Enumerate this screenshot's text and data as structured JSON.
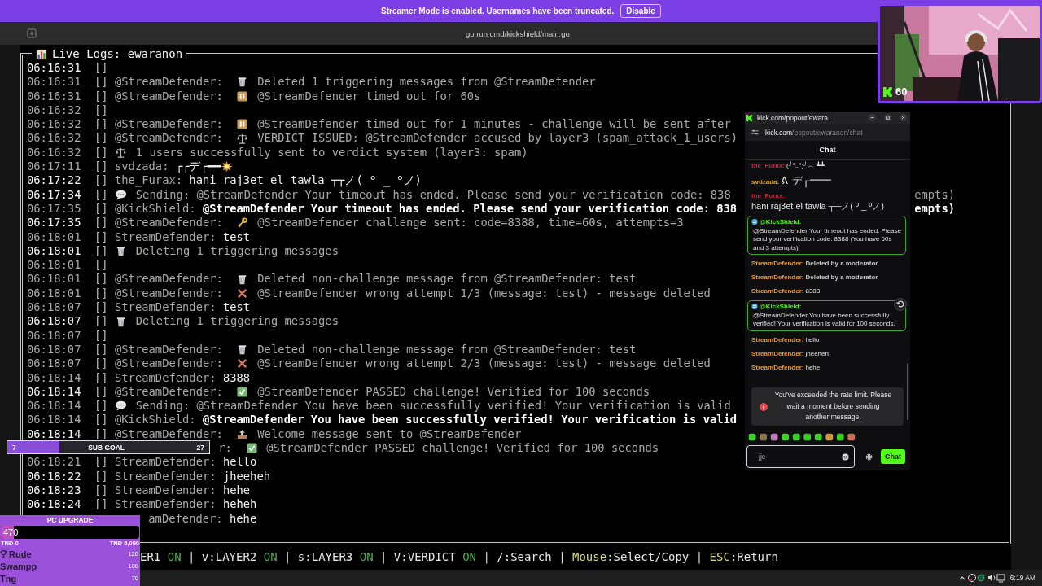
{
  "banner": {
    "text": "Streamer Mode is enabled. Usernames have been truncated.",
    "button": "Disable"
  },
  "terminal": {
    "title": "go run cmd/kickshield/main.go",
    "panel_title": "Live Logs: ewaranon",
    "lines": [
      {
        "kind": "blank",
        "time": "06:16:31",
        "bright": true,
        "tag": "[]"
      },
      {
        "kind": "trash",
        "time": "06:16:31",
        "bright": false,
        "tag": "[]",
        "author": "@StreamDefender:",
        "text": "Deleted 1 triggering messages from @StreamDefender"
      },
      {
        "kind": "pause",
        "time": "06:16:31",
        "bright": false,
        "tag": "[]",
        "author": "@StreamDefender:",
        "text": "@StreamDefender timed out for 60s"
      },
      {
        "kind": "blank",
        "time": "06:16:32",
        "bright": false,
        "tag": "[]"
      },
      {
        "kind": "pause",
        "time": "06:16:32",
        "bright": false,
        "tag": "[]",
        "author": "@StreamDefender:",
        "text": "@StreamDefender timed out for 1 minutes - challenge will be sent after"
      },
      {
        "kind": "scale",
        "time": "06:16:32",
        "bright": false,
        "tag": "[]",
        "author": "@StreamDefender:",
        "text": "VERDICT ISSUED: @StreamDefender accused by layer3 (spam_attack_1_users)"
      },
      {
        "kind": "scale",
        "time": "06:16:32",
        "bright": false,
        "tag": "[]",
        "text": "1 users successfully sent to verdict system (layer3: spam)"
      },
      {
        "kind": "burst",
        "time": "06:17:11",
        "bright": false,
        "tag": "[]",
        "author": "svdzada:",
        "text": "┌┌デ┌━━"
      },
      {
        "kind": "chat",
        "time": "06:17:22",
        "bright": true,
        "tag": "[]",
        "author": "the_Furax:",
        "text": "hani raj3et el tawla ┬┬ノ( º _ ºノ)"
      },
      {
        "kind": "speech",
        "time": "06:17:34",
        "bright": true,
        "tag": "[]",
        "text": "Sending: @StreamDefender Your timeout has ended. Please send your verification code: 838",
        "tail": "empts)"
      },
      {
        "kind": "bot",
        "time": "06:17:35",
        "bright": false,
        "tag": "[]",
        "author": "@KickShield:",
        "text": "@StreamDefender Your timeout has ended. Please send your verification code: 838",
        "tail": "empts)"
      },
      {
        "kind": "key",
        "time": "06:17:35",
        "bright": true,
        "tag": "[]",
        "author": "@StreamDefender:",
        "text": "@StreamDefender challenge sent: code=8388, time=60s, attempts=3"
      },
      {
        "kind": "chat",
        "time": "06:18:01",
        "bright": false,
        "tag": "[]",
        "author": "StreamDefender:",
        "text": "test"
      },
      {
        "kind": "trash",
        "time": "06:18:01",
        "bright": true,
        "tag": "[]",
        "text": "Deleting 1 triggering messages"
      },
      {
        "kind": "blank",
        "time": "06:18:01",
        "bright": false,
        "tag": "[]"
      },
      {
        "kind": "trash",
        "time": "06:18:01",
        "bright": false,
        "tag": "[]",
        "author": "@StreamDefender:",
        "text": "Deleted non-challenge message from @StreamDefender: test"
      },
      {
        "kind": "cross",
        "time": "06:18:01",
        "bright": false,
        "tag": "[]",
        "author": "@StreamDefender:",
        "text": "@StreamDefender wrong attempt 1/3 (message: test) - message deleted"
      },
      {
        "kind": "chat",
        "time": "06:18:07",
        "bright": false,
        "tag": "[]",
        "author": "StreamDefender:",
        "text": "test"
      },
      {
        "kind": "trash",
        "time": "06:18:07",
        "bright": true,
        "tag": "[]",
        "text": "Deleting 1 triggering messages"
      },
      {
        "kind": "blank",
        "time": "06:18:07",
        "bright": false,
        "tag": "[]"
      },
      {
        "kind": "trash",
        "time": "06:18:07",
        "bright": false,
        "tag": "[]",
        "author": "@StreamDefender:",
        "text": "Deleted non-challenge message from @StreamDefender: test"
      },
      {
        "kind": "cross",
        "time": "06:18:07",
        "bright": false,
        "tag": "[]",
        "author": "@StreamDefender:",
        "text": "@StreamDefender wrong attempt 2/3 (message: test) - message deleted"
      },
      {
        "kind": "chat",
        "time": "06:18:14",
        "bright": false,
        "tag": "[]",
        "author": "StreamDefender:",
        "text": "8388"
      },
      {
        "kind": "check",
        "time": "06:18:14",
        "bright": true,
        "tag": "[]",
        "author": "@StreamDefender:",
        "text": "@StreamDefender PASSED challenge! Verified for 100 seconds"
      },
      {
        "kind": "speech",
        "time": "06:18:14",
        "bright": false,
        "tag": "[]",
        "text": "Sending: @StreamDefender You have been successfully verified! Your verification is valid"
      },
      {
        "kind": "bot",
        "time": "06:18:14",
        "bright": false,
        "tag": "[]",
        "author": "@KickShield:",
        "text": "@StreamDefender You have been successfully verified! Your verification is valid"
      },
      {
        "kind": "outbox",
        "time": "06:18:14",
        "bright": true,
        "tag": "[]",
        "author": "@StreamDefender:",
        "text": "Welcome message sent to @StreamDefender"
      },
      {
        "kind": "check",
        "author": "r:",
        "text": "@StreamDefender PASSED challenge! Verified for 100 seconds"
      },
      {
        "kind": "chat",
        "time": "06:18:21",
        "bright": false,
        "tag": "[]",
        "author": "StreamDefender:",
        "text": "hello"
      },
      {
        "kind": "chat",
        "time": "06:18:22",
        "bright": true,
        "tag": "[]",
        "author": "StreamDefender:",
        "text": "jheeheh"
      },
      {
        "kind": "chat",
        "time": "06:18:23",
        "bright": true,
        "tag": "[]",
        "author": "StreamDefender:",
        "text": "hehe"
      },
      {
        "kind": "chat",
        "time": "06:18:24",
        "bright": true,
        "tag": "[]",
        "author": "StreamDefender:",
        "text": "heheh"
      },
      {
        "kind": "chat",
        "author": "amDefender:",
        "text": "hehe"
      }
    ],
    "status_bar": {
      "separator": "|",
      "items": [
        {
          "text": "ER1",
          "state": "ON"
        },
        {
          "text": "v:LAYER2",
          "state": "ON"
        },
        {
          "text": "s:LAYER3",
          "state": "ON"
        },
        {
          "text": "V:VERDICT",
          "state": "ON"
        },
        {
          "text": "/:Search"
        },
        {
          "key": "Mouse",
          "text": ":Select/Copy"
        },
        {
          "key": "ESC",
          "text": ":Return"
        }
      ]
    }
  },
  "chat_window": {
    "title": "kick.com/popout/ewara...",
    "url_host": "kick.com",
    "url_path": "/popout/ewaranon/chat",
    "header": "Chat",
    "messages": [
      {
        "kind": "user",
        "author": "the_Furax:",
        "color": "#c8203c",
        "text": "(╯°□°)╯︵ ┻┻"
      },
      {
        "kind": "user",
        "author": "svdzada:",
        "color": "#e0a42c",
        "text": "ᕕ·デ┌━━"
      },
      {
        "kind": "user",
        "author": "the_Furax:",
        "color": "#c8203c",
        "text": "hani raj3et el tawla ┬┬ノ( º _ ºノ)"
      },
      {
        "kind": "bot",
        "author": "@KickShield:",
        "color": "#53fc18",
        "text": "@StreamDefender Your timeout has ended. Please send your verification code: 8388 (You have 60s and 3 attempts)"
      },
      {
        "kind": "deleted",
        "author": "StreamDefender:",
        "color": "#e8962e",
        "text": "Deleted by a moderator"
      },
      {
        "kind": "deleted",
        "author": "StreamDefender:",
        "color": "#e8962e",
        "text": "Deleted by a moderator"
      },
      {
        "kind": "user",
        "author": "StreamDefender:",
        "color": "#e8962e",
        "text": "8388"
      },
      {
        "kind": "bot",
        "author": "@KickShield:",
        "color": "#53fc18",
        "text": "@StreamDefender You have been successfully verified! Your verification is valid for 100 seconds."
      },
      {
        "kind": "user",
        "author": "StreamDefender:",
        "color": "#e8962e",
        "text": "hello"
      },
      {
        "kind": "user",
        "author": "StreamDefender:",
        "color": "#e8962e",
        "text": "jheeheh"
      },
      {
        "kind": "user",
        "author": "StreamDefender:",
        "color": "#e8962e",
        "text": "hehe"
      }
    ],
    "toast": "You've exceeded the rate limit. Please wait a moment before sending another message.",
    "input_value": "jje",
    "send_button": "Chat"
  },
  "webcam": {
    "kind": "picture",
    "viewers": "60"
  },
  "sub_goal": {
    "current": "7",
    "label": "SUB GOAL",
    "target": "27",
    "level": 0.26
  },
  "pc_upgrade": {
    "title": "PC UPGRADE",
    "amount": "470",
    "level": 0.094,
    "min": "TND 0",
    "max": "TND 5,000",
    "leaders": [
      {
        "name": "Rude",
        "amount": "120",
        "top": true
      },
      {
        "name": "Swampp",
        "amount": "100",
        "top": false
      },
      {
        "name": "Tng",
        "amount": "70",
        "top": false
      }
    ]
  },
  "taskbar": {
    "time": "6:19 AM"
  }
}
